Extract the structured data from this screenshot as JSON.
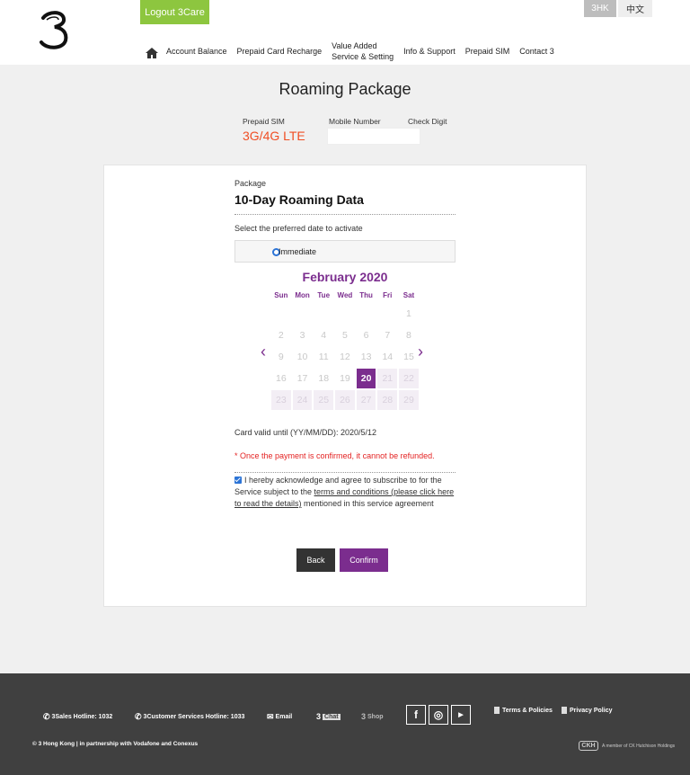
{
  "header": {
    "logout_label": "Logout 3Care",
    "lang_3hk": "3HK",
    "lang_zh": "中文",
    "nav": [
      {
        "label": "Account Balance"
      },
      {
        "label": "Prepaid Card Recharge"
      },
      {
        "label": "Value Added Service & Setting",
        "line1": "Value Added",
        "line2": "Service & Setting"
      },
      {
        "label": "Info & Support"
      },
      {
        "label": "Prepaid SIM"
      },
      {
        "label": "Contact 3"
      }
    ]
  },
  "main": {
    "title": "Roaming Package",
    "prepaid_sim_label": "Prepaid SIM",
    "prepaid_sim_value": "3G/4G LTE",
    "mobile_number_label": "Mobile Number",
    "mobile_number_value": "",
    "check_digit_label": "Check Digit",
    "package_label": "Package",
    "package_name": "10-Day Roaming Data",
    "select_date_label": "Select the preferred date to activate",
    "immediate_label": "Immediate",
    "calendar": {
      "month_title": "February 2020",
      "weekdays": [
        "Sun",
        "Mon",
        "Tue",
        "Wed",
        "Thu",
        "Fri",
        "Sat"
      ],
      "weeks": [
        [
          "",
          "",
          "",
          "",
          "",
          "",
          "1"
        ],
        [
          "2",
          "3",
          "4",
          "5",
          "6",
          "7",
          "8"
        ],
        [
          "9",
          "10",
          "11",
          "12",
          "13",
          "14",
          "15"
        ],
        [
          "16",
          "17",
          "18",
          "19",
          "20",
          "21",
          "22"
        ],
        [
          "23",
          "24",
          "25",
          "26",
          "27",
          "28",
          "29"
        ]
      ],
      "selected_day": "20"
    },
    "card_valid_text": "Card valid until (YY/MM/DD): 2020/5/12",
    "refund_notice": "* Once the payment is confirmed, it cannot be refunded.",
    "ack_prefix": "I hereby acknowledge and agree to subscribe to for the Service subject to the ",
    "ack_link": "terms and conditions (please click here to read the details)",
    "ack_suffix": " mentioned in this service agreement",
    "back_label": "Back",
    "confirm_label": "Confirm"
  },
  "footer": {
    "sales_hotline": "3Sales Hotline: 1032",
    "cs_hotline": "3Customer Services Hotline: 1033",
    "email": "Email",
    "chat": "Chat",
    "shop": "Shop",
    "terms": "Terms & Policies",
    "privacy": "Privacy Policy",
    "copyright": "© 3 Hong Kong | in partnership with Vodafone and Conexus",
    "ckh_text": "A member of CK Hutchison Holdings",
    "ckh_logo": "CKH"
  }
}
